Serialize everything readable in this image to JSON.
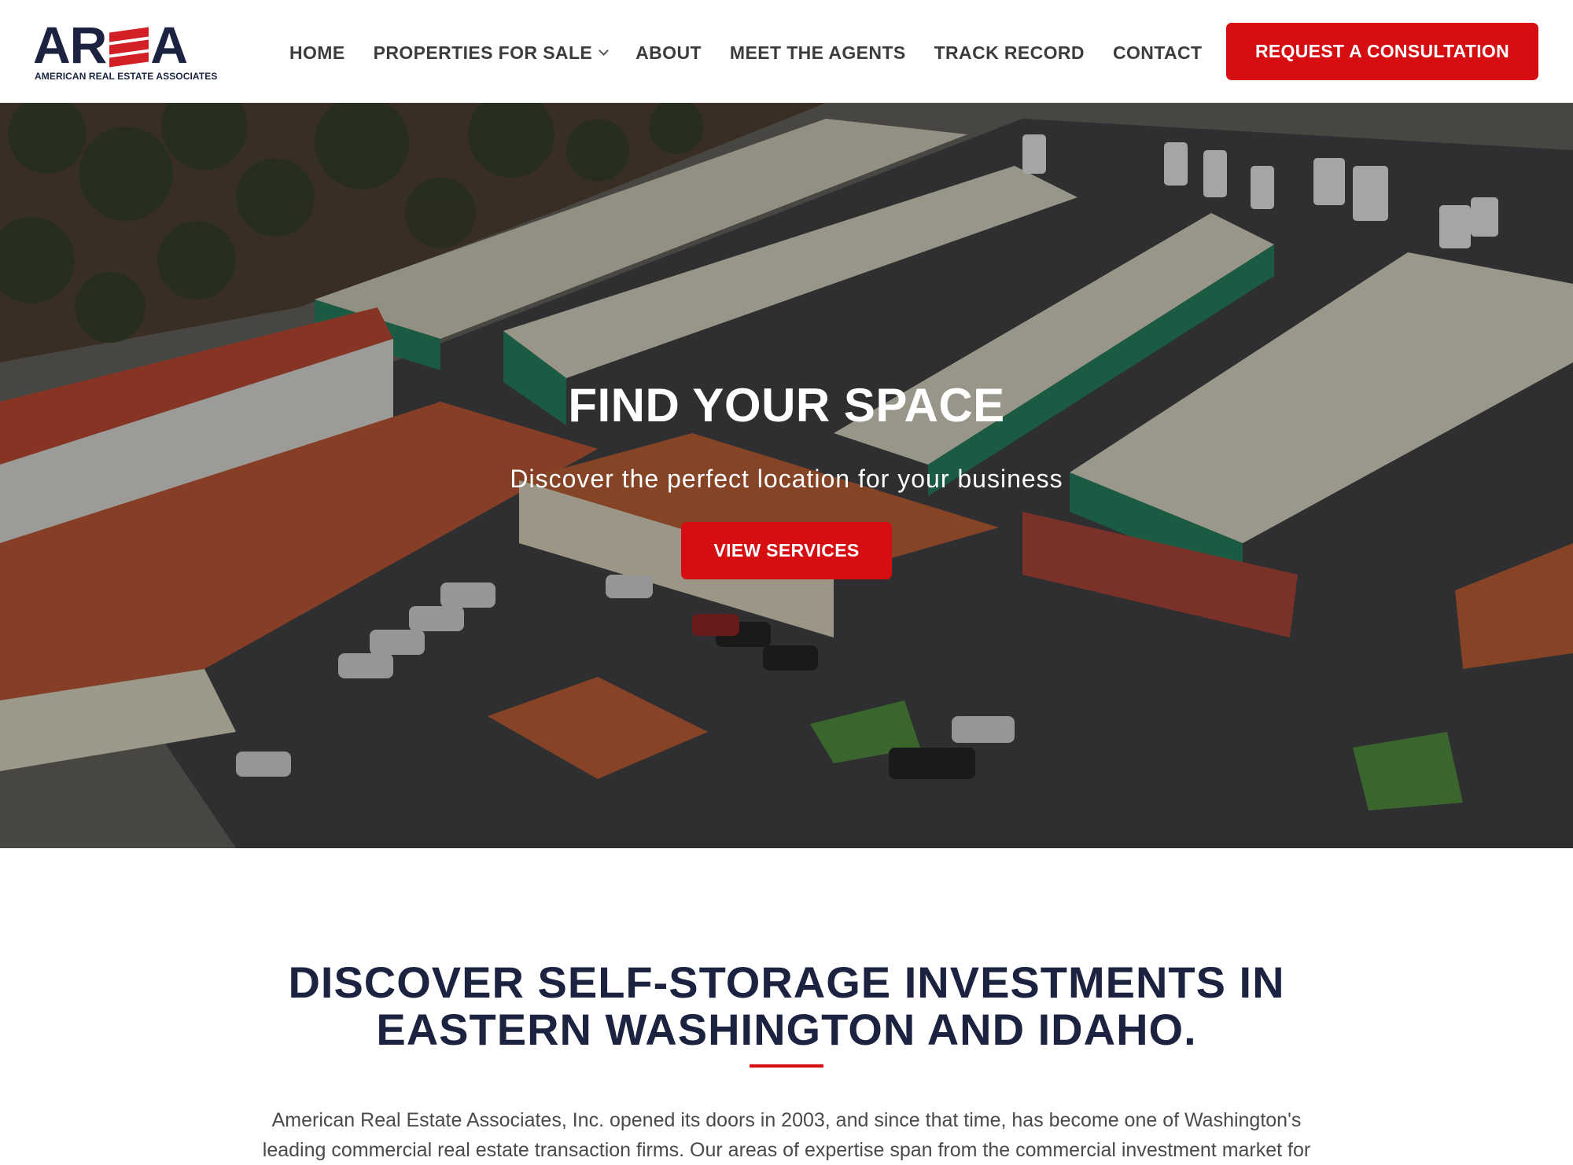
{
  "brand": {
    "logo_text": "AREA",
    "tagline": "AMERICAN REAL ESTATE ASSOCIATES",
    "primary_color": "#d60e12",
    "navy_color": "#1b2340"
  },
  "nav": {
    "items": [
      {
        "label": "HOME"
      },
      {
        "label": "PROPERTIES FOR SALE"
      },
      {
        "label": "ABOUT"
      },
      {
        "label": "MEET THE AGENTS"
      },
      {
        "label": "TRACK RECORD"
      },
      {
        "label": "CONTACT"
      }
    ],
    "cta_label": "REQUEST A CONSULTATION"
  },
  "hero": {
    "title": "FIND YOUR SPACE",
    "subtitle": "Discover the perfect location for your business",
    "button_label": "VIEW SERVICES"
  },
  "intro": {
    "title_line1": "DISCOVER SELF-STORAGE INVESTMENTS IN",
    "title_line2": "EASTERN WASHINGTON AND IDAHO.",
    "body_line1": "American Real Estate Associates, Inc. opened its doors in 2003, and since that time, has become one of Washington's",
    "body_line2": "leading commercial real estate transaction firms. Our areas of expertise span from the commercial investment market for"
  }
}
